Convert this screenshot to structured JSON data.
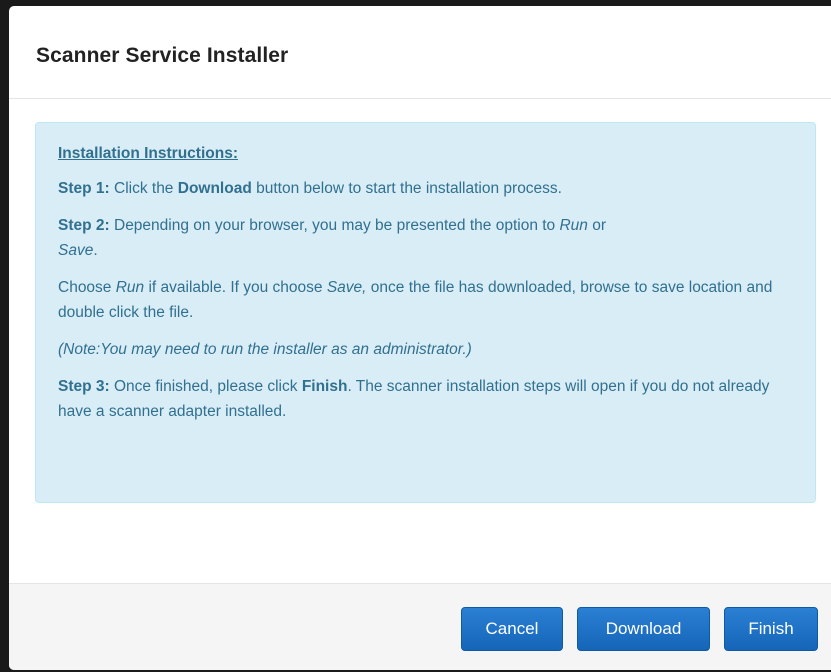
{
  "dialog": {
    "title": "Scanner Service Installer"
  },
  "instructions": {
    "heading": "Installation Instructions:",
    "step1": {
      "label": "Step 1:",
      "text_before": " Click the ",
      "bold": "Download",
      "text_after": " button below to start the installation process."
    },
    "step2": {
      "label": "Step 2:",
      "text_before": " Depending on your browser, you may be presented the option to ",
      "run": "Run",
      "or": " or ",
      "save": "Save",
      "end": "."
    },
    "choose": {
      "text1": "Choose ",
      "run": "Run",
      "text2": " if available. If you choose ",
      "save": "Save,",
      "text3": " once the file has downloaded, browse to save location and double click the file."
    },
    "note": "(Note:You may need to run the installer as an administrator.)",
    "step3": {
      "label": "Step 3:",
      "text_before": " Once finished, please click ",
      "bold": "Finish",
      "text_after": ". The scanner installation steps will open if you do not already have a scanner adapter installed."
    }
  },
  "footer": {
    "cancel_label": "Cancel",
    "download_label": "Download",
    "finish_label": "Finish"
  },
  "colors": {
    "alert_bg": "#d9edf7",
    "alert_text": "#31708f",
    "button_primary": "#1a6fc2"
  }
}
